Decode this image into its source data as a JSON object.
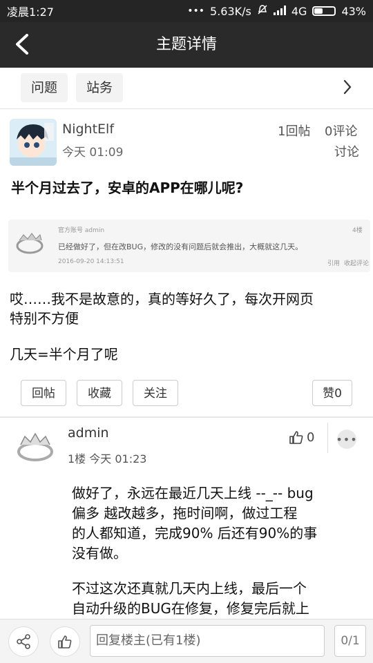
{
  "status_bar": {
    "time": "凌晨1:27",
    "network_speed": "5.63K/s",
    "network_type": "4G",
    "battery": "43%",
    "battery_level": 0.43
  },
  "app_bar": {
    "title": "主题详情"
  },
  "tags": [
    "问题",
    "站务"
  ],
  "post": {
    "author": "NightElf",
    "time": "今天 01:09",
    "replies": "1回帖",
    "comments": "0评论",
    "discuss": "讨论",
    "title": "半个月过去了，安卓的APP在哪儿呢?",
    "quote": {
      "author_line": "官方账号 admin",
      "floor": "4楼",
      "text": "已经做好了，但在改BUG，修改的没有问题后就会推出，大概就这几天。",
      "time": "2016-09-20 14:13:51",
      "quote_action": "引用",
      "collect_action": "收起评论"
    },
    "paragraphs": [
      "哎……我不是故意的，真的等好久了，每次开网页",
      "特别不方便",
      "几天=半个月了呢"
    ],
    "buttons": {
      "reply": "回帖",
      "favorite": "收藏",
      "follow": "关注",
      "like": "赞0"
    }
  },
  "reply": {
    "author": "admin",
    "floor_time": "1楼 今天 01:23",
    "likes": "0",
    "lines": [
      "做好了，永远在最近几天上线 --_-- bug",
      "偏多 越改越多，拖时间啊，做过工程",
      "的人都知道，完成90% 后还有90%的事",
      "没有做。",
      "不过这次还真就几天内上线，最后一个",
      "自动升级的BUG在修复，修复完后就上"
    ]
  },
  "bottom_bar": {
    "input_placeholder": "回复楼主(已有1楼)",
    "page_indicator": "0/1"
  }
}
